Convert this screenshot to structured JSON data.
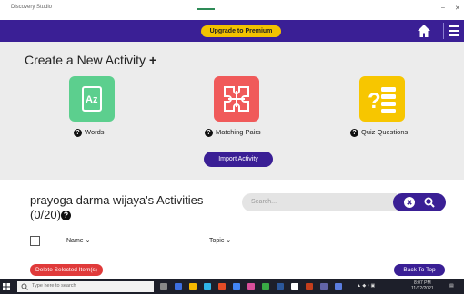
{
  "window": {
    "app_title": "Discovery Studio",
    "minimize": "–",
    "close": "✕"
  },
  "navbar": {
    "premium_label": "Upgrade to Premium",
    "home_icon": "home-icon",
    "menu_icon": "menu-icon"
  },
  "create": {
    "title": "Create a New Activity",
    "plus": "+",
    "tiles": [
      {
        "label": "Words",
        "icon": "az-icon",
        "color": "#5ccf8e"
      },
      {
        "label": "Matching Pairs",
        "icon": "puzzle-icon",
        "color": "#f05a5a"
      },
      {
        "label": "Quiz Questions",
        "icon": "quiz-icon",
        "color": "#f7c600"
      }
    ],
    "import_label": "Import Activity"
  },
  "activities": {
    "title_line1": "prayoga darma wijaya's Activities",
    "title_line2": "(0/20)",
    "search_placeholder": "Search...",
    "columns": [
      {
        "label": "Name"
      },
      {
        "label": "Topic"
      }
    ],
    "delete_label": "Delete Selected Item(s)",
    "back_label": "Back To Top"
  },
  "taskbar": {
    "search_placeholder": "Type here to search",
    "tray_time": "8:07 PM",
    "tray_date": "11/12/2021"
  },
  "colors": {
    "brand": "#3a1f95",
    "premium": "#f2c200",
    "delete": "#e03a3a"
  }
}
